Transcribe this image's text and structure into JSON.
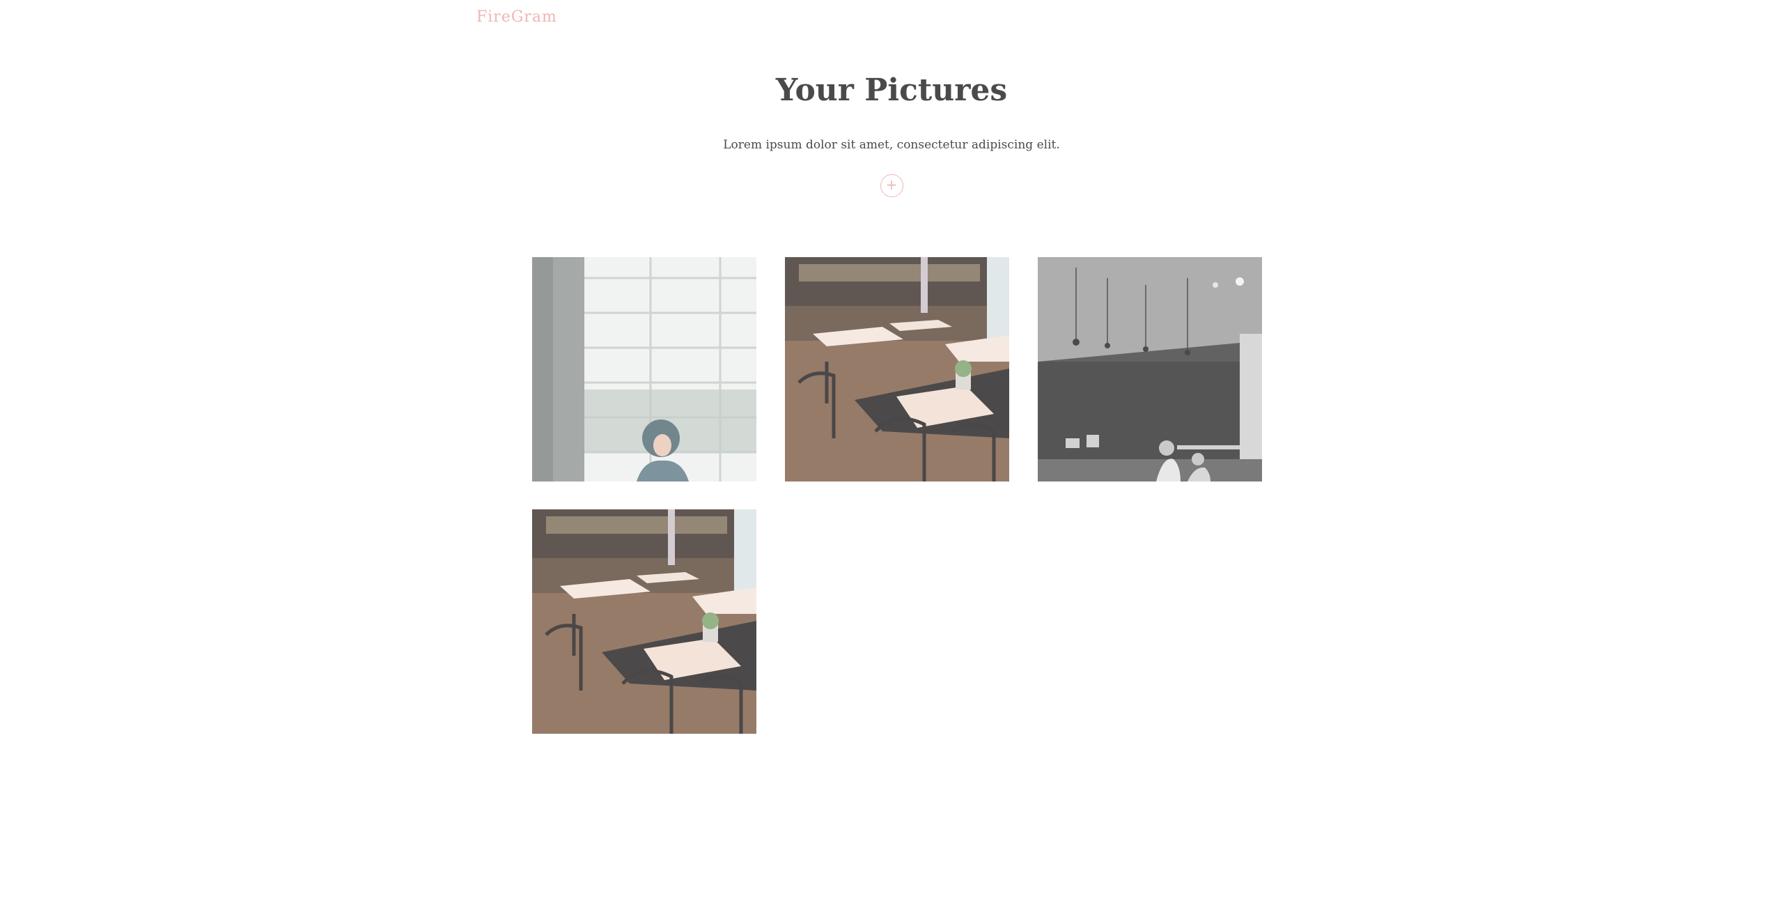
{
  "nav": {
    "brand": "FireGram"
  },
  "hero": {
    "title": "Your Pictures",
    "subtitle": "Lorem ipsum dolor sit amet, consectetur adipiscing elit.",
    "upload_label": "+"
  },
  "theme": {
    "accent": "#efb6b2",
    "text": "#4a4a4a",
    "background": "#ffffff"
  },
  "gallery": {
    "photos": [
      {
        "subject": "woman-by-window"
      },
      {
        "subject": "cafe-tables-color"
      },
      {
        "subject": "cafe-interior-bw"
      },
      {
        "subject": "cafe-tables-color"
      }
    ]
  }
}
